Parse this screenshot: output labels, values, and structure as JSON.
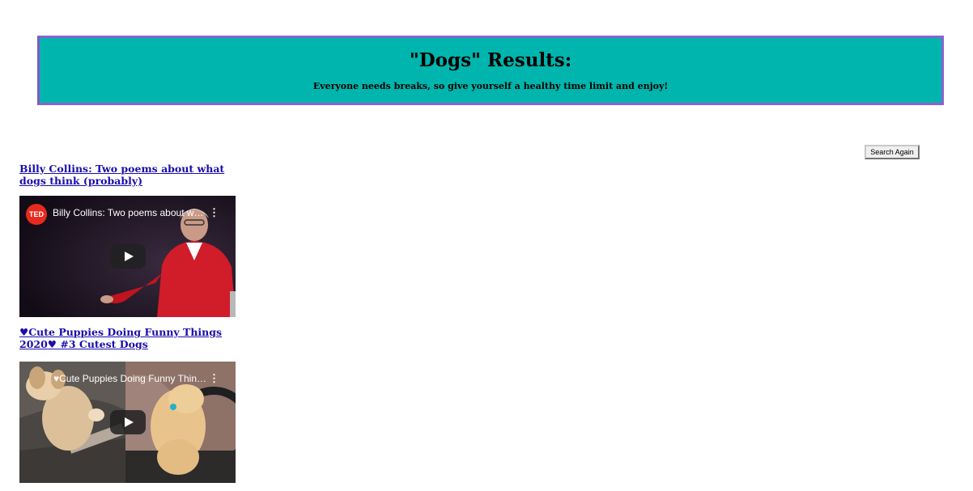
{
  "header": {
    "title": "\"Dogs\" Results:",
    "subtitle": "Everyone needs breaks, so give yourself a healthy time limit and enjoy!"
  },
  "search_again_label": "Search Again",
  "results": [
    {
      "title": "Billy Collins: Two poems about what dogs think (probably)",
      "video_title": "Billy Collins: Two poems about what dogs think (probably)",
      "channel_badge": "TED"
    },
    {
      "title": "♥Cute Puppies Doing Funny Things 2020♥ #3 Cutest Dogs",
      "video_title": "♥Cute Puppies Doing Funny Things 2020♥ #3 Cutest Dogs"
    }
  ],
  "icons": {
    "kebab": "⋮"
  },
  "colors": {
    "header_bg": "#00b5ad",
    "header_border": "#8a63d2",
    "link": "#1a0dab"
  }
}
